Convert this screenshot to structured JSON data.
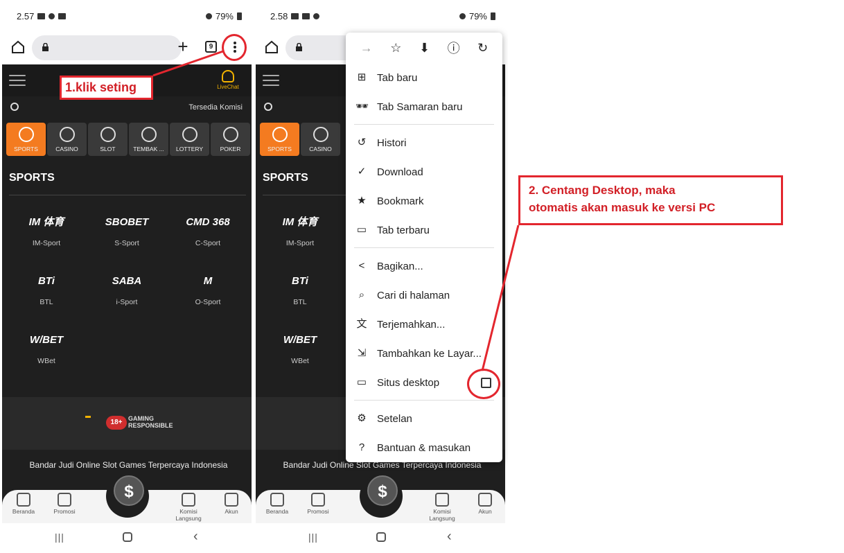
{
  "status_left": [
    "2.57",
    "2.58"
  ],
  "battery": "79%",
  "tabs_count": "9",
  "site": {
    "livechat": "LiveChat",
    "tersedia_komisi": "Tersedia Komisi",
    "categories": [
      "SPORTS",
      "CASINO",
      "SLOT",
      "TEMBAK ...",
      "LOTTERY",
      "POKER"
    ],
    "section_title": "SPORTS",
    "providers": [
      {
        "logo": "IM 体育",
        "name": "IM-Sport"
      },
      {
        "logo": "SBOBET",
        "name": "S-Sport"
      },
      {
        "logo": "CMD 368",
        "name": "C-Sport"
      },
      {
        "logo": "BTi",
        "name": "BTL"
      },
      {
        "logo": "SABA",
        "name": "i-Sport"
      },
      {
        "logo": "M",
        "name": "O-Sport"
      },
      {
        "logo": "W/BET",
        "name": "WBet"
      }
    ],
    "responsible_badge": "18+",
    "responsible_text_1": "GAMING",
    "responsible_text_2": "RESPONSIBLE",
    "footer_text": "Bandar Judi Online Slot Games Terpercaya Indonesia",
    "bottom_nav": [
      "Beranda",
      "Promosi",
      "Komisi Langsung",
      "Akun"
    ],
    "fab_symbol": "$"
  },
  "menu": {
    "top_icons": [
      "→",
      "☆",
      "⬇",
      "ⓘ",
      "↻"
    ],
    "items": [
      {
        "icon": "⊞",
        "label": "Tab baru"
      },
      {
        "icon": "🕶",
        "label": "Tab Samaran baru"
      },
      {
        "icon": "↺",
        "label": "Histori"
      },
      {
        "icon": "✓",
        "label": "Download"
      },
      {
        "icon": "★",
        "label": "Bookmark"
      },
      {
        "icon": "▭",
        "label": "Tab terbaru"
      },
      {
        "icon": "<",
        "label": "Bagikan..."
      },
      {
        "icon": "⌕",
        "label": "Cari di halaman"
      },
      {
        "icon": "文",
        "label": "Terjemahkan..."
      },
      {
        "icon": "⇲",
        "label": "Tambahkan ke Layar..."
      },
      {
        "icon": "▭",
        "label": "Situs desktop"
      },
      {
        "icon": "⚙",
        "label": "Setelan"
      },
      {
        "icon": "?",
        "label": "Bantuan & masukan"
      }
    ]
  },
  "annotations": {
    "step1": "1.klik seting",
    "step2_line1": "2. Centang Desktop, maka",
    "step2_line2": "otomatis akan masuk ke versi PC",
    "color": "#e3262e"
  }
}
